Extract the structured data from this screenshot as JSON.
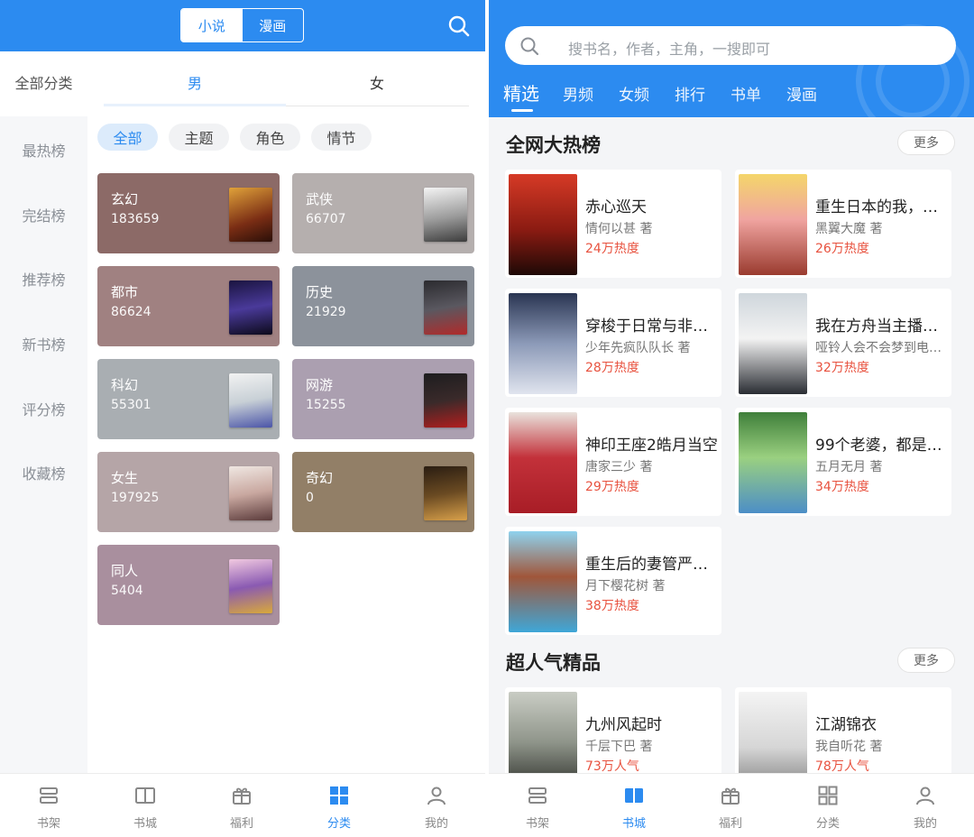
{
  "colors": {
    "accent": "#2c8bf0",
    "heat": "#e8523f"
  },
  "left": {
    "segment": {
      "novel": "小说",
      "comic": "漫画"
    },
    "sidebar": [
      "全部分类",
      "最热榜",
      "完结榜",
      "推荐榜",
      "新书榜",
      "评分榜",
      "收藏榜"
    ],
    "gender_tabs": [
      "男",
      "女"
    ],
    "chips": [
      "全部",
      "主题",
      "角色",
      "情节"
    ],
    "categories": [
      {
        "name": "玄幻",
        "count": "183659",
        "color": "#8c6a67"
      },
      {
        "name": "武侠",
        "count": "66707",
        "color": "#b5afae"
      },
      {
        "name": "都市",
        "count": "86624",
        "color": "#a08181"
      },
      {
        "name": "历史",
        "count": "21929",
        "color": "#8c929b"
      },
      {
        "name": "科幻",
        "count": "55301",
        "color": "#a9aeb2"
      },
      {
        "name": "网游",
        "count": "15255",
        "color": "#ab9fb0"
      },
      {
        "name": "女生",
        "count": "197925",
        "color": "#b5a5a7"
      },
      {
        "name": "奇幻",
        "count": "0",
        "color": "#927f67"
      },
      {
        "name": "同人",
        "count": "5404",
        "color": "#a98f9e"
      }
    ]
  },
  "right": {
    "search_placeholder": "搜书名，作者，主角，一搜即可",
    "nav_tabs": [
      "精选",
      "男频",
      "女频",
      "排行",
      "书单",
      "漫画"
    ],
    "section1": {
      "title": "全网大热榜",
      "more": "更多",
      "books": [
        {
          "title": "赤心巡天",
          "author": "情何以甚 著",
          "heat": "24万热度"
        },
        {
          "title": "重生日本的我，在…",
          "author": "黑翼大魔 著",
          "heat": "26万热度"
        },
        {
          "title": "穿梭于日常与非日…",
          "author": "少年先疯队队长 著",
          "heat": "28万热度"
        },
        {
          "title": "我在方舟当主播，…",
          "author": "哑铃人会不会梦到电…",
          "heat": "32万热度"
        },
        {
          "title": "神印王座2皓月当空",
          "author": "唐家三少 著",
          "heat": "29万热度"
        },
        {
          "title": "99个老婆，都是我…",
          "author": "五月无月 著",
          "heat": "34万热度"
        },
        {
          "title": "重生后的妻管严生…",
          "author": "月下樱花树 著",
          "heat": "38万热度"
        }
      ]
    },
    "section2": {
      "title": "超人气精品",
      "more": "更多",
      "books": [
        {
          "title": "九州风起时",
          "author": "千层下巴 著",
          "heat": "73万人气"
        },
        {
          "title": "江湖锦衣",
          "author": "我自听花 著",
          "heat": "78万人气"
        }
      ]
    }
  },
  "tabbar": [
    "书架",
    "书城",
    "福利",
    "分类",
    "我的"
  ]
}
